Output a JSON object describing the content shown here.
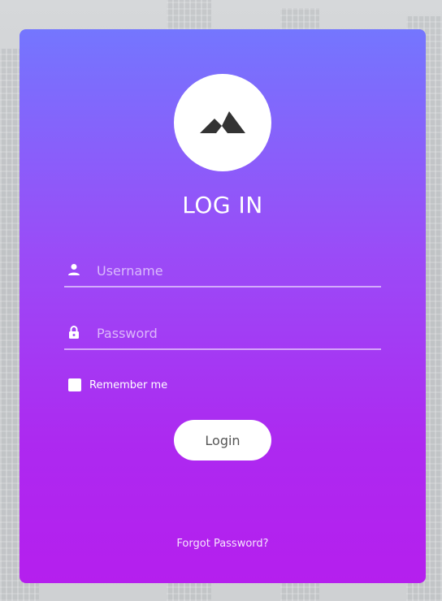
{
  "login": {
    "title": "LOG IN",
    "username_placeholder": "Username",
    "password_placeholder": "Password",
    "remember_label": "Remember me",
    "login_button_label": "Login",
    "forgot_password_label": "Forgot Password?"
  },
  "icons": {
    "logo": "mountain-icon",
    "username": "user-icon",
    "password": "lock-icon"
  },
  "colors": {
    "card_gradient_top": "#7476fe",
    "card_gradient_bottom": "#b51fee",
    "button_background": "#ffffff",
    "button_text": "#555555",
    "text_primary": "#ffffff"
  }
}
